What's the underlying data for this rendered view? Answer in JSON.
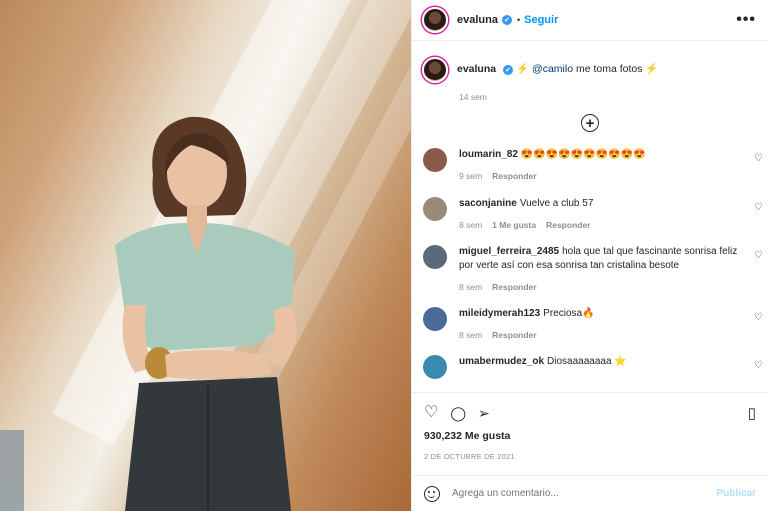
{
  "header": {
    "username": "evaluna",
    "verified_icon": "✔",
    "separator": "•",
    "follow_label": "Seguir",
    "more_icon": "•••"
  },
  "caption": {
    "username": "evaluna",
    "verified_icon": "✔",
    "bolt1": "⚡",
    "mention": "@camilo",
    "text": "me toma fotos",
    "bolt2": "⚡",
    "time": "14 sem"
  },
  "load_more_icon": "+",
  "comments": [
    {
      "user": "loumarin_82",
      "text": "😍😍😍😍😍😍😍😍😍😍",
      "time": "9 sem",
      "likes": "",
      "reply": "Responder",
      "avatar_color": "#8a5a4a"
    },
    {
      "user": "saconjanine",
      "text": "Vuelve a club 57",
      "time": "8 sem",
      "likes": "1 Me gusta",
      "reply": "Responder",
      "avatar_color": "#9a8a7a"
    },
    {
      "user": "miguel_ferreira_2485",
      "text": "hola que tal que fascinante sonrisa feliz por verte así con esa sonrisa tan cristalina besote",
      "time": "8 sem",
      "likes": "",
      "reply": "Responder",
      "avatar_color": "#5a6a7a"
    },
    {
      "user": "mileidymerah123",
      "text": "Preciosa🔥",
      "time": "8 sem",
      "likes": "",
      "reply": "Responder",
      "avatar_color": "#4a6a9a"
    },
    {
      "user": "umabermudez_ok",
      "text": "Diosaaaaaaaa ⭐",
      "time": "",
      "likes": "",
      "reply": "",
      "avatar_color": "#3a8ab0"
    }
  ],
  "actions": {
    "like_icon": "♡",
    "comment_icon": "◯",
    "share_icon": "➢",
    "save_icon": "▯"
  },
  "likes_text": "930,232 Me gusta",
  "date_text": "2 DE OCTUBRE DE 2021",
  "add_comment": {
    "placeholder": "Agrega un comentario...",
    "publish_label": "Publicar"
  }
}
